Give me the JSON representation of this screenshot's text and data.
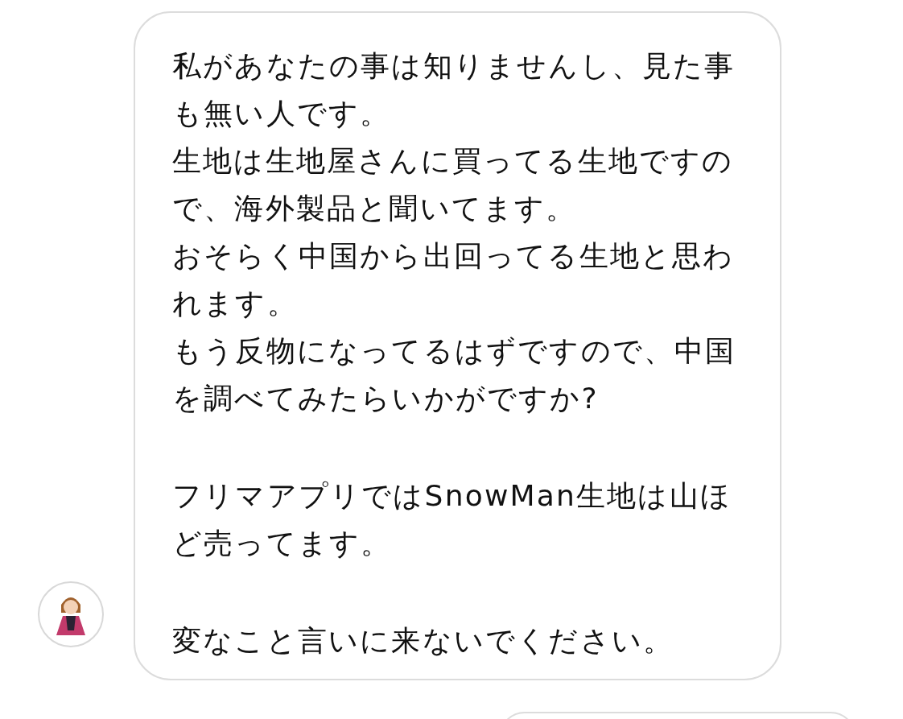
{
  "messages": [
    {
      "blocks": [
        [
          "私があなたの事は知りませんし、見た事も無い人です。",
          "生地は生地屋さんに買ってる生地ですので、海外製品と聞いてます。",
          "おそらく中国から出回ってる生地と思われます。",
          "もう反物になってるはずですので、中国を調べてみたらいかがですか?"
        ],
        [
          "フリマアプリではSnowMan生地は山ほど売ってます。"
        ],
        [
          "変なこと言いに来ないでください。"
        ]
      ]
    }
  ]
}
